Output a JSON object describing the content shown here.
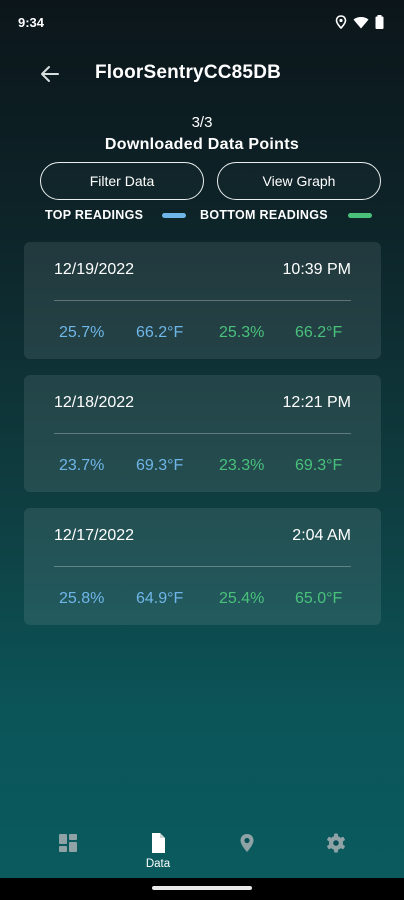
{
  "status_bar": {
    "time": "9:34",
    "icons": [
      "location-icon",
      "wifi-icon",
      "battery-icon"
    ]
  },
  "header": {
    "title": "FloorSentryCC85DB",
    "back_icon": "arrow-back-icon"
  },
  "summary": {
    "count": "3/3",
    "subtitle": "Downloaded Data Points"
  },
  "actions": {
    "filter_label": "Filter Data",
    "graph_label": "View Graph"
  },
  "legend": {
    "top_label": "TOP READINGS",
    "bottom_label": "BOTTOM READINGS",
    "top_color": "#6fb6e8",
    "bottom_color": "#49c17b"
  },
  "records": [
    {
      "date": "12/19/2022",
      "time": "10:39 PM",
      "top_humidity": "25.7%",
      "top_temp": "66.2°F",
      "bottom_humidity": "25.3%",
      "bottom_temp": "66.2°F"
    },
    {
      "date": "12/18/2022",
      "time": "12:21 PM",
      "top_humidity": "23.7%",
      "top_temp": "69.3°F",
      "bottom_humidity": "23.3%",
      "bottom_temp": "69.3°F"
    },
    {
      "date": "12/17/2022",
      "time": "2:04 AM",
      "top_humidity": "25.8%",
      "top_temp": "64.9°F",
      "bottom_humidity": "25.4%",
      "bottom_temp": "65.0°F"
    }
  ],
  "nav": {
    "items": [
      {
        "icon": "dashboard-icon",
        "label": "",
        "active": false
      },
      {
        "icon": "document-icon",
        "label": "Data",
        "active": true
      },
      {
        "icon": "location-pin-icon",
        "label": "",
        "active": false
      },
      {
        "icon": "gear-icon",
        "label": "",
        "active": false
      }
    ]
  },
  "colors": {
    "top": "#6fb6e8",
    "bottom": "#49c17b",
    "nav_inactive": "#8fa3a6",
    "nav_active": "#ffffff"
  }
}
